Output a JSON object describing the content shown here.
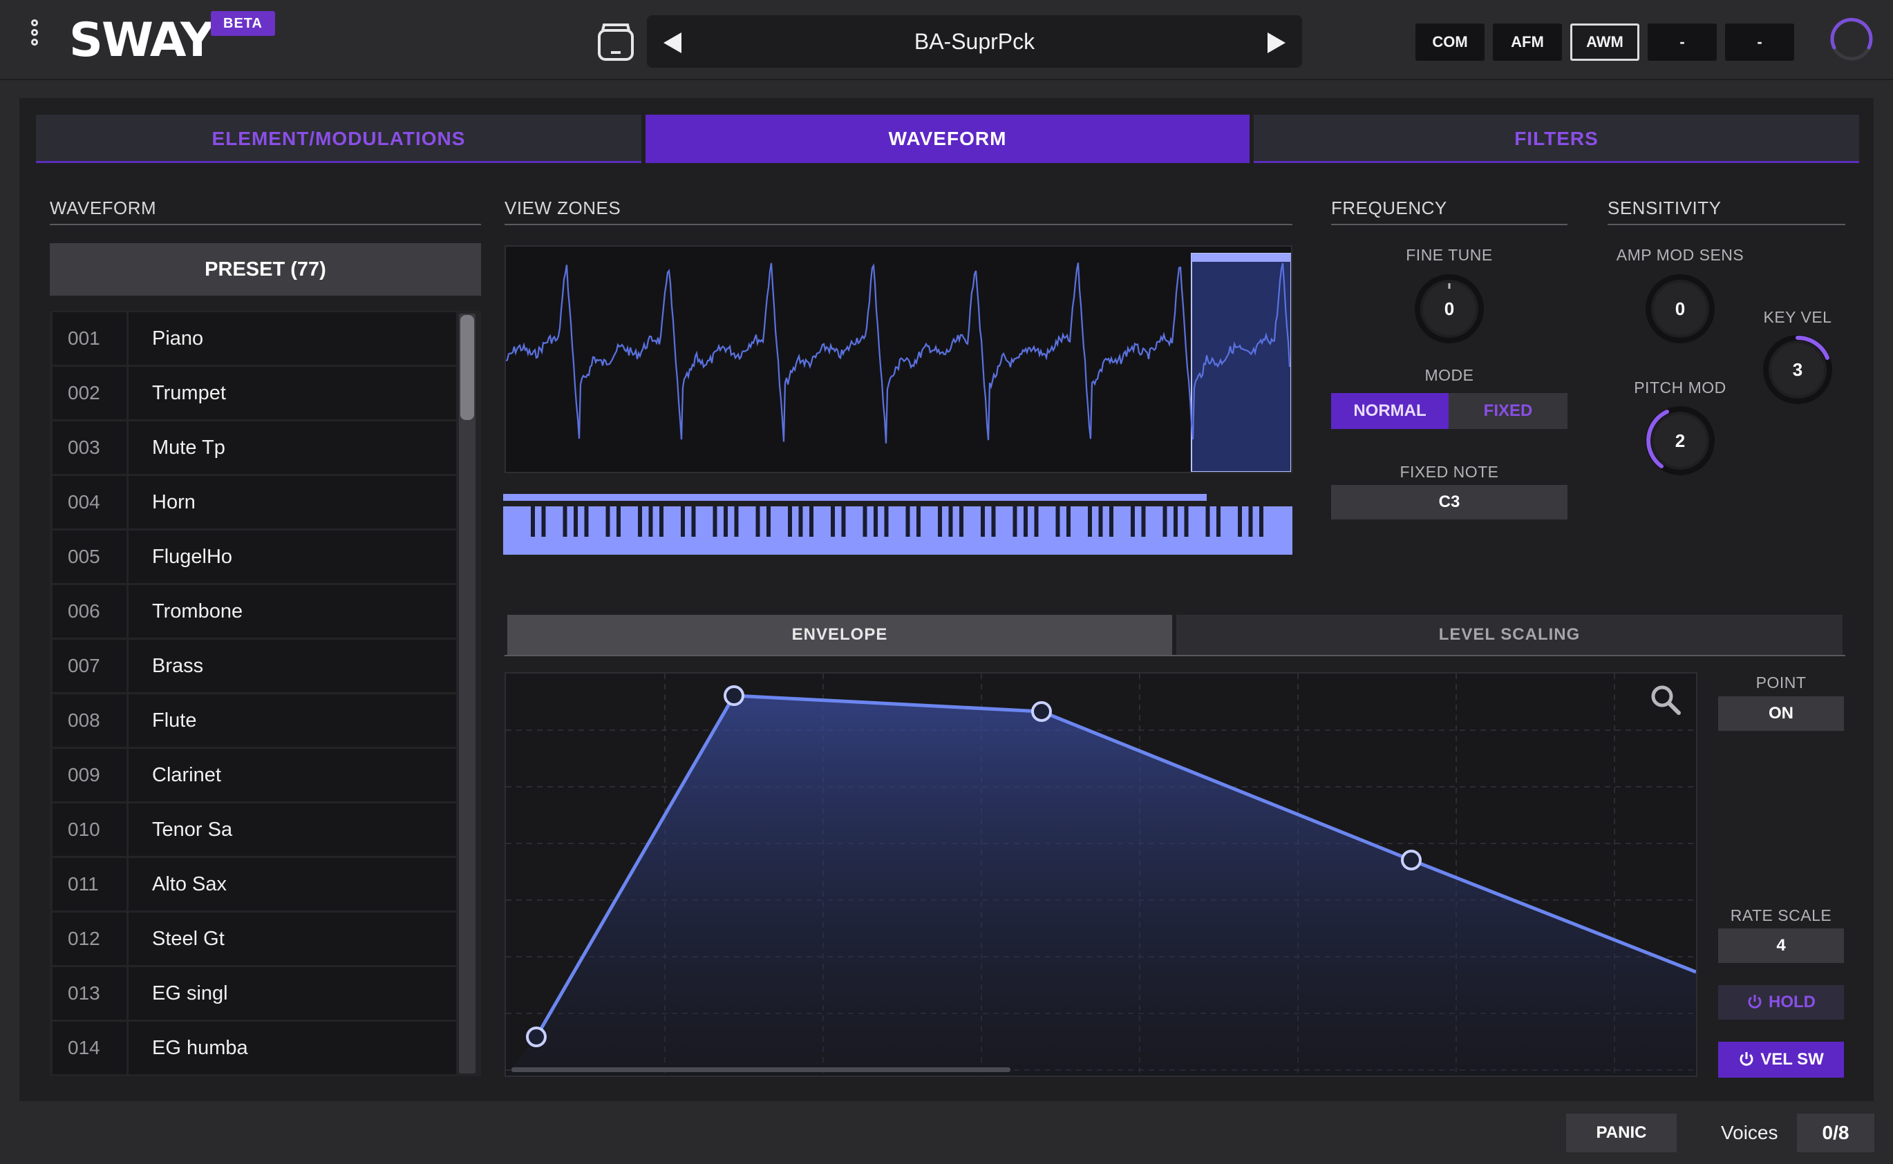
{
  "app": {
    "logo": "SWAY",
    "badge": "BETA"
  },
  "header": {
    "preset_name": "BA-SuprPck",
    "prev_icon": "triangle-left-icon",
    "next_icon": "triangle-right-icon",
    "mode_buttons": [
      "COM",
      "AFM",
      "AWM",
      "-",
      "-"
    ],
    "active_mode": "AWM"
  },
  "tabs": [
    {
      "label": "ELEMENT/MODULATIONS",
      "active": false
    },
    {
      "label": "WAVEFORM",
      "active": true
    },
    {
      "label": "FILTERS",
      "active": false
    }
  ],
  "waveform": {
    "title": "WAVEFORM",
    "preset_header": "PRESET (77)",
    "presets": [
      {
        "num": "001",
        "name": "Piano"
      },
      {
        "num": "002",
        "name": "Trumpet"
      },
      {
        "num": "003",
        "name": "Mute Tp"
      },
      {
        "num": "004",
        "name": "Horn"
      },
      {
        "num": "005",
        "name": "FlugelHo"
      },
      {
        "num": "006",
        "name": "Trombone"
      },
      {
        "num": "007",
        "name": "Brass"
      },
      {
        "num": "008",
        "name": "Flute"
      },
      {
        "num": "009",
        "name": "Clarinet"
      },
      {
        "num": "010",
        "name": "Tenor Sa"
      },
      {
        "num": "011",
        "name": "Alto Sax"
      },
      {
        "num": "012",
        "name": "Steel Gt"
      },
      {
        "num": "013",
        "name": "EG singl"
      },
      {
        "num": "014",
        "name": "EG humba"
      }
    ]
  },
  "view_zones": {
    "title": "VIEW ZONES"
  },
  "frequency": {
    "title": "FREQUENCY",
    "fine_tune_label": "FINE TUNE",
    "fine_tune_value": "0",
    "mode_label": "MODE",
    "mode_options": [
      "NORMAL",
      "FIXED"
    ],
    "mode_selected": "NORMAL",
    "fixed_note_label": "FIXED NOTE",
    "fixed_note_value": "C3"
  },
  "sensitivity": {
    "title": "SENSITIVITY",
    "amp_mod_sens_label": "AMP MOD SENS",
    "amp_mod_sens_value": "0",
    "pitch_mod_label": "PITCH MOD",
    "pitch_mod_value": "2",
    "key_vel_label": "KEY VEL",
    "key_vel_value": "3"
  },
  "envelope": {
    "tabs": [
      "ENVELOPE",
      "LEVEL SCALING"
    ],
    "active_tab": "ENVELOPE",
    "point_label": "POINT",
    "point_value": "ON",
    "rate_scale_label": "RATE SCALE",
    "rate_scale_value": "4",
    "hold_label": "HOLD",
    "vel_sw_label": "VEL SW",
    "zoom_icon": "magnifier-icon",
    "power_icon": "power-icon"
  },
  "footer": {
    "panic_label": "PANIC",
    "voices_label": "Voices",
    "voices_value": "0/8"
  },
  "colors": {
    "accent_purple": "#5d27c6",
    "accent_purple_text": "#8a4fe6",
    "waveform_blue": "#5b72e0",
    "envelope_line": "#6c86f0",
    "zone_highlight": "#8a97ff"
  }
}
